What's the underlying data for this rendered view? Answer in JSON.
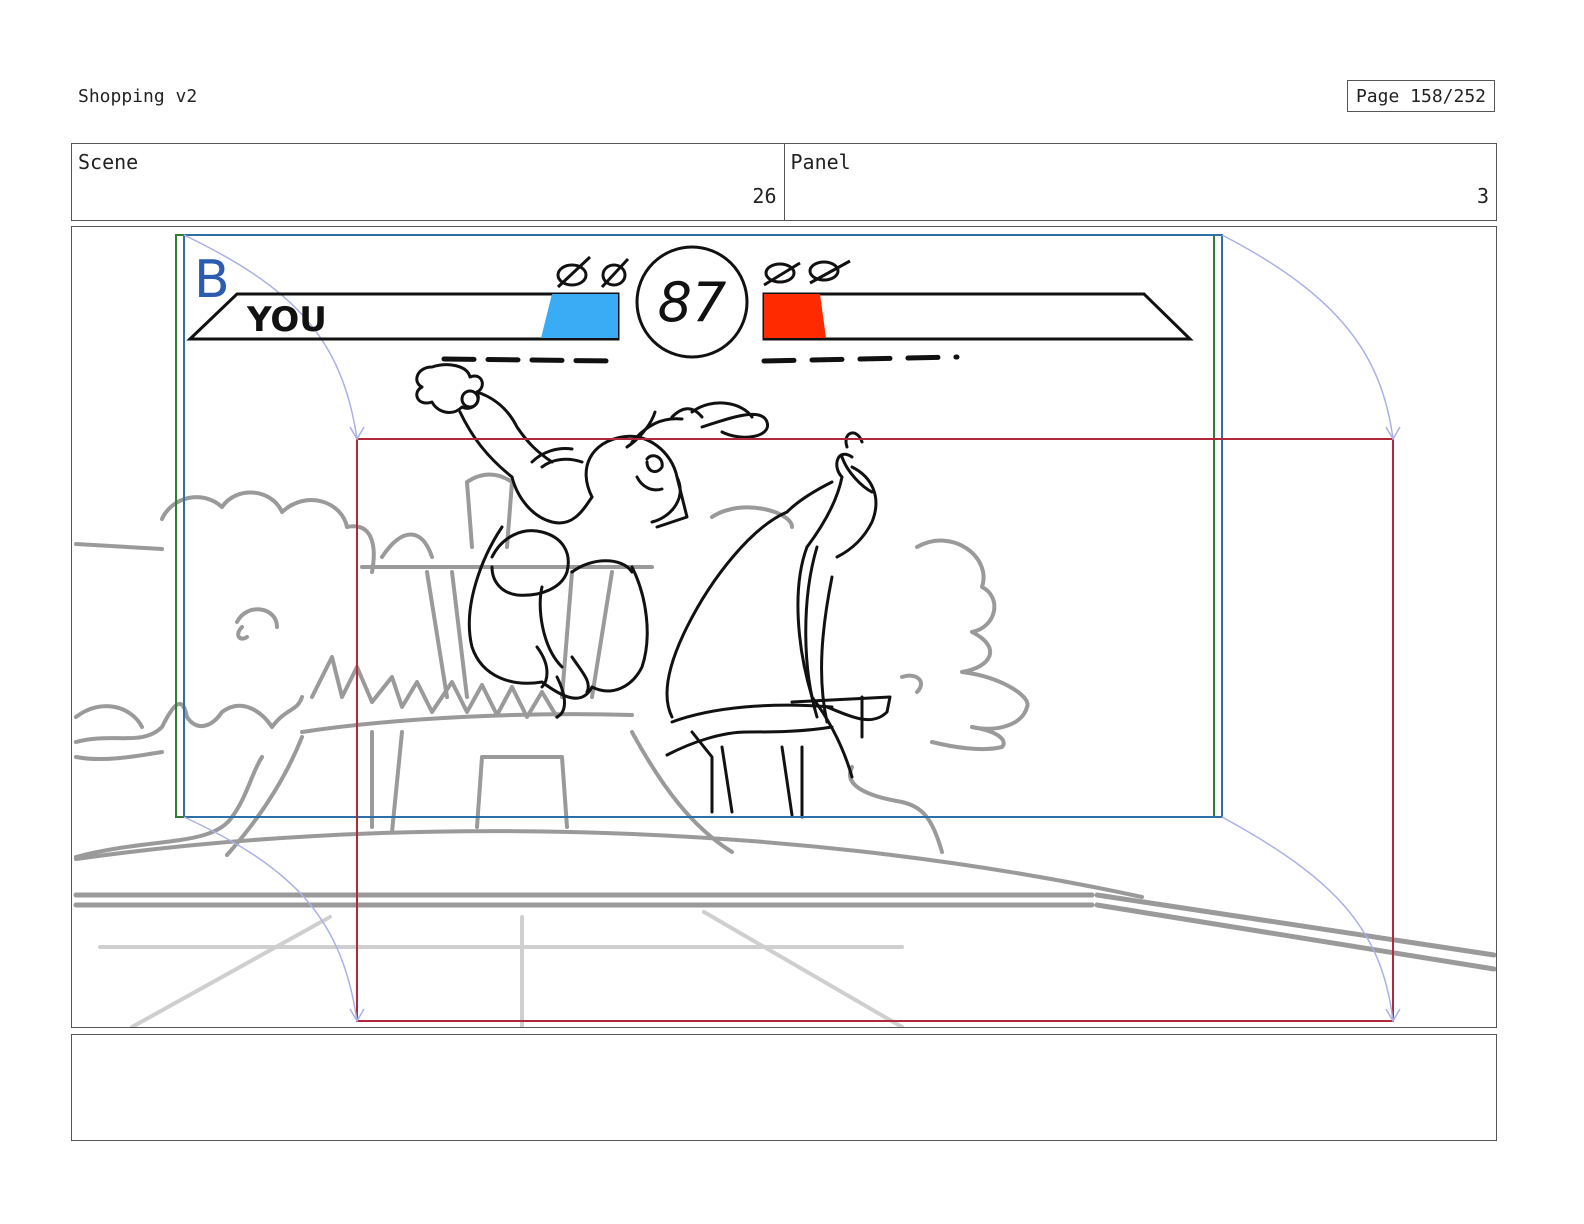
{
  "header": {
    "title": "Shopping v2",
    "page": "Page 158/252"
  },
  "info": {
    "scene_label": "Scene",
    "scene_value": "26",
    "panel_label": "Panel",
    "panel_value": "3"
  },
  "frame": {
    "hud": {
      "frame_letter": "B",
      "player_label": "YOU",
      "timer": "87"
    },
    "colors": {
      "player_bar": "#3aabf5",
      "enemy_bar": "#ff2a00",
      "frame_letter": "#2d5bb0",
      "camera_green": "#2e7d32",
      "camera_blue": "#2f6fa8",
      "camera_red": "#b0283a",
      "motion_path": "#aab0e8"
    }
  },
  "notes": {
    "text": ""
  }
}
